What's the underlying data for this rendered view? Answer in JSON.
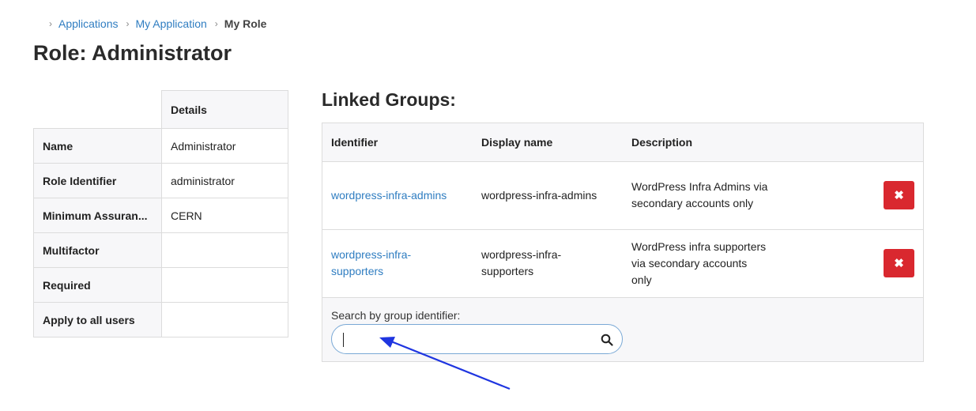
{
  "breadcrumb": {
    "items": [
      "Applications",
      "My Application"
    ],
    "current": "My Role"
  },
  "page_title": "Role: Administrator",
  "details": {
    "header": "Details",
    "rows": [
      {
        "key": "Name",
        "value": "Administrator"
      },
      {
        "key": "Role Identifier",
        "value": "administrator"
      },
      {
        "key": "Minimum Assuran...",
        "value": "CERN"
      },
      {
        "key": "Multifactor",
        "value": ""
      },
      {
        "key": "Required",
        "value": ""
      },
      {
        "key": "Apply to all users",
        "value": ""
      }
    ]
  },
  "linked_groups": {
    "title": "Linked Groups:",
    "columns": [
      "Identifier",
      "Display name",
      "Description"
    ],
    "rows": [
      {
        "identifier": "wordpress-infra-admins",
        "display_name": "wordpress-infra-admins",
        "description": "WordPress Infra Admins via secondary accounts only",
        "delete_icon": "✖"
      },
      {
        "identifier": "wordpress-infra-supporters",
        "display_name": "wordpress-infra-supporters",
        "description": "WordPress infra supporters via secondary accounts only",
        "delete_icon": "✖"
      }
    ],
    "search": {
      "label": "Search by group identifier:",
      "value": ""
    }
  },
  "colors": {
    "link": "#2f7dc1",
    "danger": "#d9282f",
    "annotation_arrow": "#1f35e0"
  }
}
